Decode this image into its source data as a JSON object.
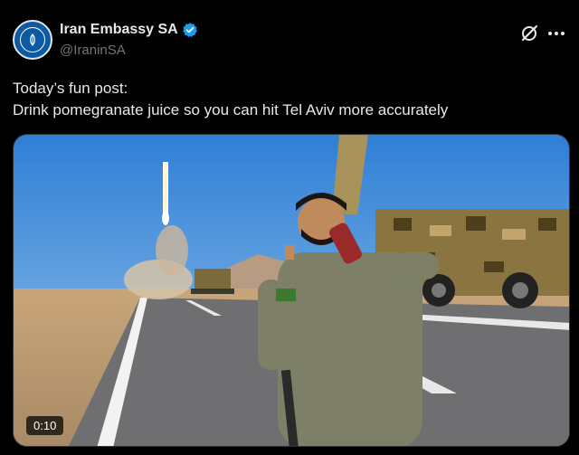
{
  "post": {
    "display_name": "Iran Embassy SA",
    "handle": "@IraninSA",
    "text_line1": "Today’s fun post:",
    "text_line2": "Drink pomegranate juice so you can hit Tel Aviv more accurately",
    "video_duration": "0:10"
  },
  "icons": {
    "verified": "verified-badge-icon",
    "grok": "grok-icon",
    "more": "more-options-icon"
  },
  "colors": {
    "background": "#000000",
    "text_primary": "#e7e9ea",
    "text_secondary": "#71767b",
    "verified_blue": "#1d9bf0"
  }
}
